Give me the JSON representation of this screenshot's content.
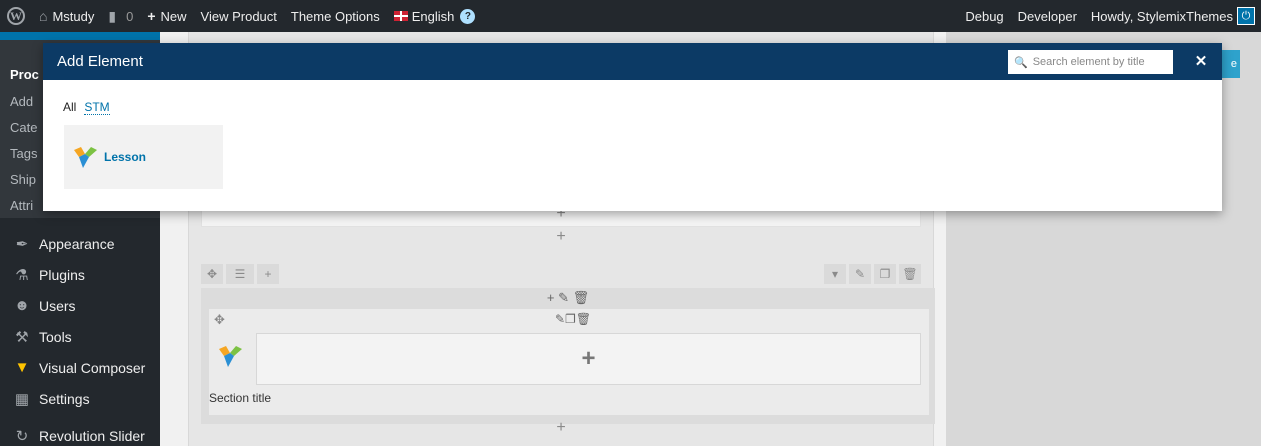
{
  "admin_bar": {
    "site_name": "Mstudy",
    "comments_count": "0",
    "new_label": "New",
    "view_product": "View Product",
    "theme_options": "Theme Options",
    "language": "English",
    "debug": "Debug",
    "developer": "Developer",
    "howdy": "Howdy, StylemixThemes"
  },
  "sidebar": {
    "submenu_head": "Proc",
    "submenu_items": [
      "Add",
      "Cate",
      "Tags",
      "Ship",
      "Attri"
    ],
    "items": [
      {
        "label": "Appearance",
        "icon": "paint-brush-icon"
      },
      {
        "label": "Plugins",
        "icon": "plug-icon"
      },
      {
        "label": "Users",
        "icon": "users-icon"
      },
      {
        "label": "Tools",
        "icon": "wrench-icon"
      },
      {
        "label": "Visual Composer",
        "icon": "visual-composer-icon"
      },
      {
        "label": "Settings",
        "icon": "settings-icon"
      },
      {
        "label": "Revolution Slider",
        "icon": "refresh-icon"
      }
    ]
  },
  "editor": {
    "section_title": "Section title",
    "publish_fragment": "e"
  },
  "modal": {
    "title": "Add Element",
    "search_placeholder": "Search element by title",
    "tabs": [
      "All",
      "STM"
    ],
    "elements": [
      {
        "label": "Lesson"
      }
    ]
  },
  "colors": {
    "admin_bar_bg": "#23282d",
    "modal_header_bg": "#0c3a65",
    "link_blue": "#0073aa"
  }
}
